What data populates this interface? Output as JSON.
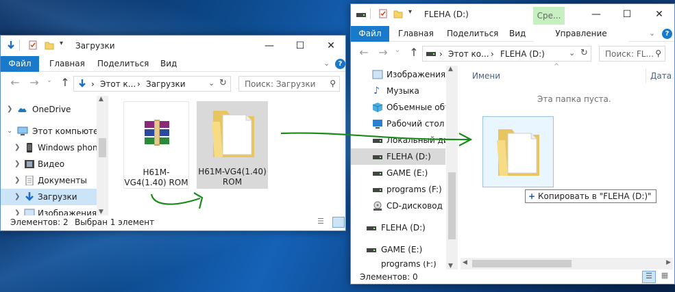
{
  "left_window": {
    "title": "Загрузки",
    "tabs": [
      "Файл",
      "Главная",
      "Поделиться",
      "Вид"
    ],
    "address": [
      "Этот к...",
      "Загрузки"
    ],
    "search_placeholder": "Поиск: Загрузки",
    "nav": [
      {
        "label": "OneDrive",
        "icon": "onedrive-icon"
      },
      {
        "label": "Этот компьютер",
        "icon": "computer-icon"
      },
      {
        "label": "Windows phone",
        "icon": "phone-icon"
      },
      {
        "label": "Видео",
        "icon": "video-icon"
      },
      {
        "label": "Документы",
        "icon": "documents-icon"
      },
      {
        "label": "Загрузки",
        "icon": "downloads-icon",
        "selected": true
      },
      {
        "label": "Изображения",
        "icon": "pictures-icon"
      }
    ],
    "files": [
      {
        "name": "H61M-VG4(1.40) ROM",
        "icon": "winrar-archive-icon"
      },
      {
        "name": "H61M-VG4(1.40) ROM",
        "icon": "folder-icon",
        "selected": true
      }
    ],
    "status_count": "Элементов: 2",
    "status_selected": "Выбран 1 элемент"
  },
  "right_window": {
    "title": "FLEHA (D:)",
    "context_tab": "Сре...",
    "tabs": [
      "Файл",
      "Главная",
      "Поделиться",
      "Вид"
    ],
    "manage_tab": "Управление",
    "address": [
      "Этот ко...",
      "FLEHA (D:)"
    ],
    "search_placeholder": "Поиск: FL...",
    "nav": [
      {
        "label": "Изображения",
        "icon": "pictures-icon"
      },
      {
        "label": "Музыка",
        "icon": "music-icon"
      },
      {
        "label": "Объемные объ",
        "icon": "3d-objects-icon"
      },
      {
        "label": "Рабочий стол",
        "icon": "desktop-icon"
      },
      {
        "label": "Локальный дис",
        "icon": "drive-icon"
      },
      {
        "label": "FLEHA (D:)",
        "icon": "usb-drive-icon",
        "selected": true
      },
      {
        "label": "GAME (E:)",
        "icon": "drive-icon"
      },
      {
        "label": "programs (F:)",
        "icon": "drive-icon"
      },
      {
        "label": "CD-дисковод (H",
        "icon": "cd-drive-icon"
      },
      {
        "label": "FLEHA (D:)",
        "icon": "usb-drive-icon"
      },
      {
        "label": "GAME (E:)",
        "icon": "drive-icon"
      },
      {
        "label": "programs (F:)",
        "icon": "drive-icon"
      }
    ],
    "col_name": "Имени",
    "col_date": "Дата и",
    "empty_text": "Эта папка пуста.",
    "copy_tooltip": "Копировать в \"FLEHA (D:)\"",
    "status_count": "Элементов: 0"
  },
  "colors": {
    "accent": "#1979ca",
    "selection": "#cce4f7",
    "arrow": "#1a8a1a",
    "context_tab": "#c7f0c0"
  }
}
